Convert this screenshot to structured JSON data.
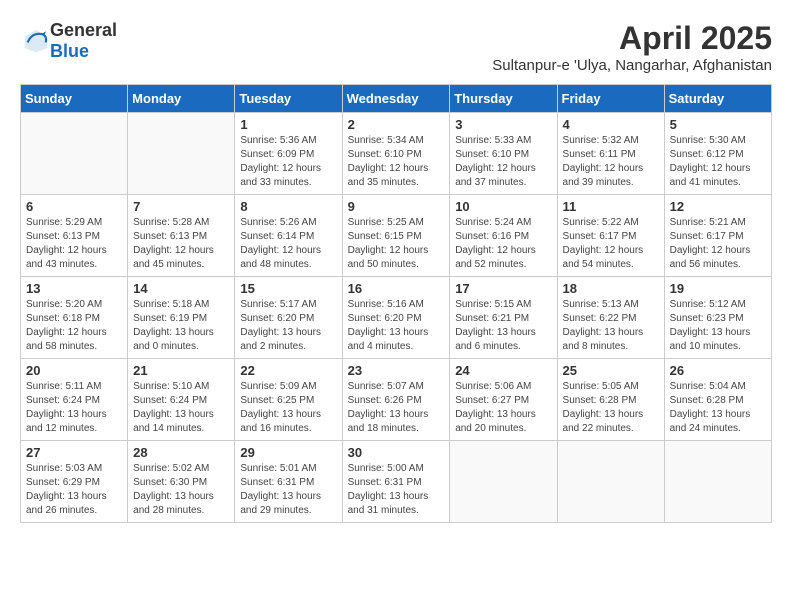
{
  "header": {
    "logo_general": "General",
    "logo_blue": "Blue",
    "title": "April 2025",
    "subtitle": "Sultanpur-e 'Ulya, Nangarhar, Afghanistan"
  },
  "calendar": {
    "weekdays": [
      "Sunday",
      "Monday",
      "Tuesday",
      "Wednesday",
      "Thursday",
      "Friday",
      "Saturday"
    ],
    "weeks": [
      [
        {
          "day": "",
          "info": ""
        },
        {
          "day": "",
          "info": ""
        },
        {
          "day": "1",
          "info": "Sunrise: 5:36 AM\nSunset: 6:09 PM\nDaylight: 12 hours and 33 minutes."
        },
        {
          "day": "2",
          "info": "Sunrise: 5:34 AM\nSunset: 6:10 PM\nDaylight: 12 hours and 35 minutes."
        },
        {
          "day": "3",
          "info": "Sunrise: 5:33 AM\nSunset: 6:10 PM\nDaylight: 12 hours and 37 minutes."
        },
        {
          "day": "4",
          "info": "Sunrise: 5:32 AM\nSunset: 6:11 PM\nDaylight: 12 hours and 39 minutes."
        },
        {
          "day": "5",
          "info": "Sunrise: 5:30 AM\nSunset: 6:12 PM\nDaylight: 12 hours and 41 minutes."
        }
      ],
      [
        {
          "day": "6",
          "info": "Sunrise: 5:29 AM\nSunset: 6:13 PM\nDaylight: 12 hours and 43 minutes."
        },
        {
          "day": "7",
          "info": "Sunrise: 5:28 AM\nSunset: 6:13 PM\nDaylight: 12 hours and 45 minutes."
        },
        {
          "day": "8",
          "info": "Sunrise: 5:26 AM\nSunset: 6:14 PM\nDaylight: 12 hours and 48 minutes."
        },
        {
          "day": "9",
          "info": "Sunrise: 5:25 AM\nSunset: 6:15 PM\nDaylight: 12 hours and 50 minutes."
        },
        {
          "day": "10",
          "info": "Sunrise: 5:24 AM\nSunset: 6:16 PM\nDaylight: 12 hours and 52 minutes."
        },
        {
          "day": "11",
          "info": "Sunrise: 5:22 AM\nSunset: 6:17 PM\nDaylight: 12 hours and 54 minutes."
        },
        {
          "day": "12",
          "info": "Sunrise: 5:21 AM\nSunset: 6:17 PM\nDaylight: 12 hours and 56 minutes."
        }
      ],
      [
        {
          "day": "13",
          "info": "Sunrise: 5:20 AM\nSunset: 6:18 PM\nDaylight: 12 hours and 58 minutes."
        },
        {
          "day": "14",
          "info": "Sunrise: 5:18 AM\nSunset: 6:19 PM\nDaylight: 13 hours and 0 minutes."
        },
        {
          "day": "15",
          "info": "Sunrise: 5:17 AM\nSunset: 6:20 PM\nDaylight: 13 hours and 2 minutes."
        },
        {
          "day": "16",
          "info": "Sunrise: 5:16 AM\nSunset: 6:20 PM\nDaylight: 13 hours and 4 minutes."
        },
        {
          "day": "17",
          "info": "Sunrise: 5:15 AM\nSunset: 6:21 PM\nDaylight: 13 hours and 6 minutes."
        },
        {
          "day": "18",
          "info": "Sunrise: 5:13 AM\nSunset: 6:22 PM\nDaylight: 13 hours and 8 minutes."
        },
        {
          "day": "19",
          "info": "Sunrise: 5:12 AM\nSunset: 6:23 PM\nDaylight: 13 hours and 10 minutes."
        }
      ],
      [
        {
          "day": "20",
          "info": "Sunrise: 5:11 AM\nSunset: 6:24 PM\nDaylight: 13 hours and 12 minutes."
        },
        {
          "day": "21",
          "info": "Sunrise: 5:10 AM\nSunset: 6:24 PM\nDaylight: 13 hours and 14 minutes."
        },
        {
          "day": "22",
          "info": "Sunrise: 5:09 AM\nSunset: 6:25 PM\nDaylight: 13 hours and 16 minutes."
        },
        {
          "day": "23",
          "info": "Sunrise: 5:07 AM\nSunset: 6:26 PM\nDaylight: 13 hours and 18 minutes."
        },
        {
          "day": "24",
          "info": "Sunrise: 5:06 AM\nSunset: 6:27 PM\nDaylight: 13 hours and 20 minutes."
        },
        {
          "day": "25",
          "info": "Sunrise: 5:05 AM\nSunset: 6:28 PM\nDaylight: 13 hours and 22 minutes."
        },
        {
          "day": "26",
          "info": "Sunrise: 5:04 AM\nSunset: 6:28 PM\nDaylight: 13 hours and 24 minutes."
        }
      ],
      [
        {
          "day": "27",
          "info": "Sunrise: 5:03 AM\nSunset: 6:29 PM\nDaylight: 13 hours and 26 minutes."
        },
        {
          "day": "28",
          "info": "Sunrise: 5:02 AM\nSunset: 6:30 PM\nDaylight: 13 hours and 28 minutes."
        },
        {
          "day": "29",
          "info": "Sunrise: 5:01 AM\nSunset: 6:31 PM\nDaylight: 13 hours and 29 minutes."
        },
        {
          "day": "30",
          "info": "Sunrise: 5:00 AM\nSunset: 6:31 PM\nDaylight: 13 hours and 31 minutes."
        },
        {
          "day": "",
          "info": ""
        },
        {
          "day": "",
          "info": ""
        },
        {
          "day": "",
          "info": ""
        }
      ]
    ]
  }
}
